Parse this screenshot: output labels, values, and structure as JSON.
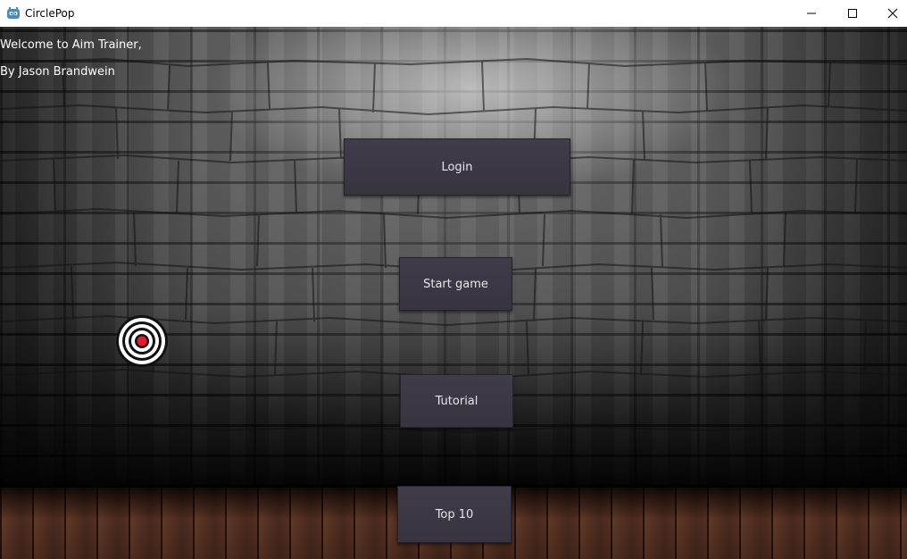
{
  "window": {
    "title": "CirclePop",
    "app_icon": "godot-icon",
    "controls": {
      "minimize_icon": "minimize-icon",
      "maximize_icon": "maximize-icon",
      "close_icon": "close-icon"
    }
  },
  "main": {
    "welcome": "Welcome to Aim Trainer,",
    "author": "By Jason Brandwein",
    "buttons": {
      "login": "Login",
      "start_game": "Start game",
      "tutorial": "Tutorial",
      "top10": "Top 10"
    },
    "target_icon": "target-icon"
  },
  "colors": {
    "button_bg": "#3b3844",
    "button_text": "#e6e6ea",
    "target_center": "#e8192c"
  }
}
